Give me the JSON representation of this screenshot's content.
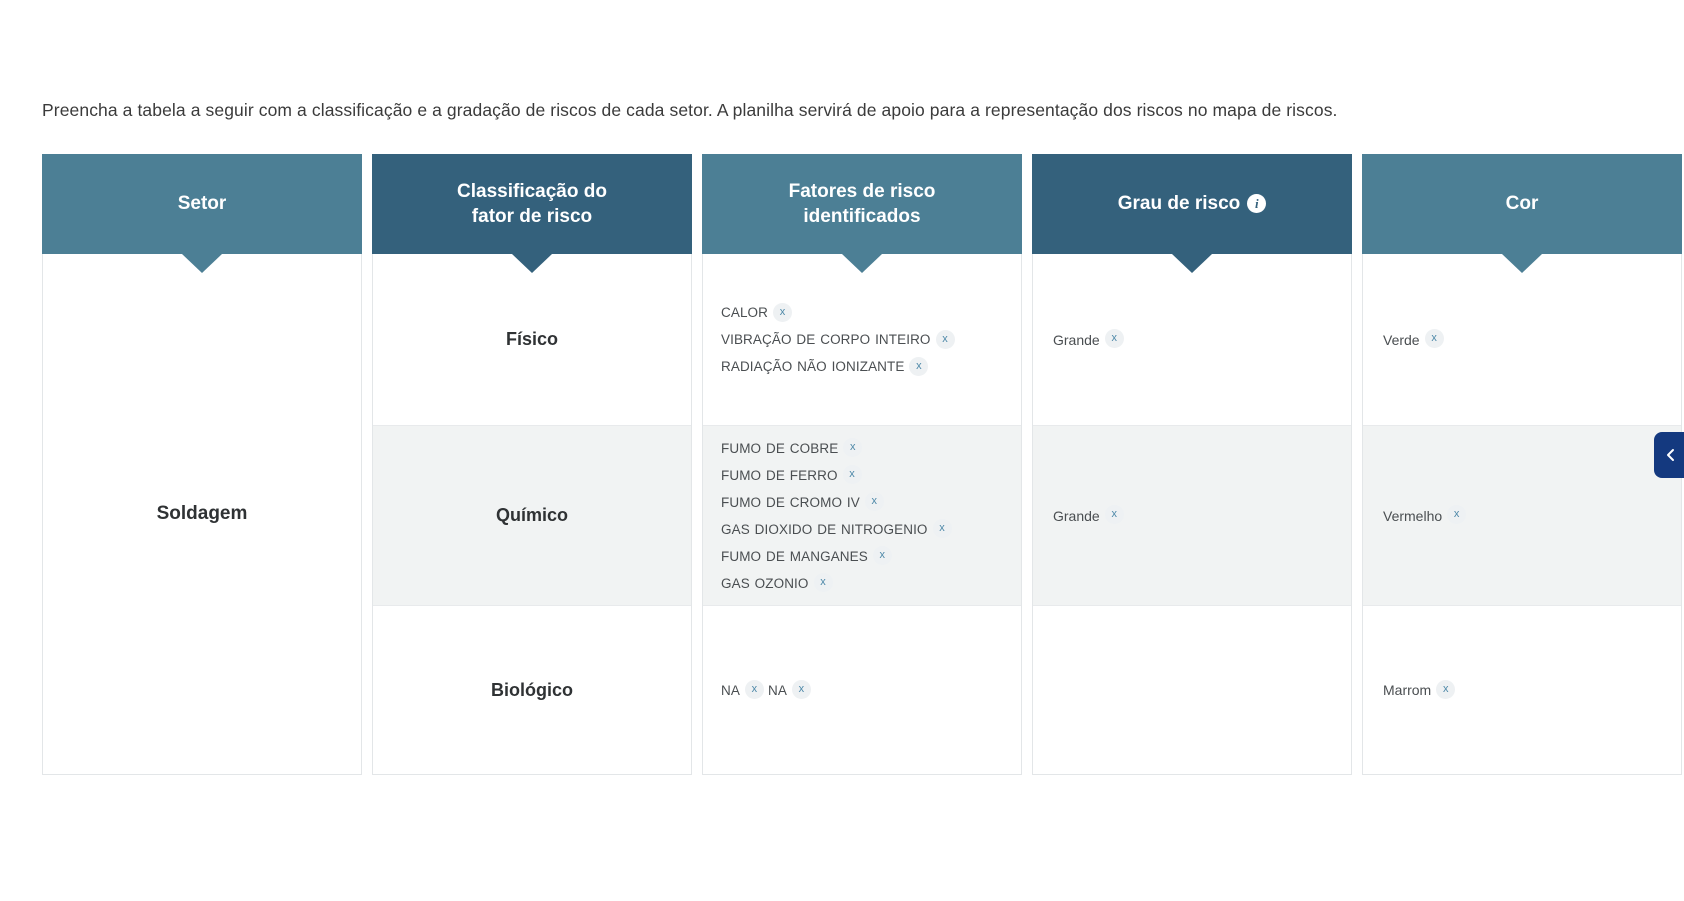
{
  "intro": {
    "text": "Preencha a tabela a seguir com a classificação e a gradação de riscos de cada setor. A planilha servirá de apoio para a representação dos riscos no mapa de riscos."
  },
  "table": {
    "headers": [
      {
        "label": "Setor",
        "tone": "light"
      },
      {
        "label": "Classificação do\nfator de risco",
        "tone": "dark"
      },
      {
        "label": "Fatores de risco\nidentificados",
        "tone": "light"
      },
      {
        "label": "Grau de risco",
        "tone": "dark",
        "icon": "info-icon"
      },
      {
        "label": "Cor",
        "tone": "light"
      }
    ],
    "sector": "Soldagem",
    "rows": [
      {
        "classification": "Físico",
        "factors": [
          "CALOR",
          "VIBRAÇÃO DE CORPO INTEIRO",
          "RADIAÇÃO NÃO IONIZANTE"
        ],
        "grade": "Grande",
        "color": "Verde",
        "shaded": false
      },
      {
        "classification": "Químico",
        "factors": [
          "FUMO DE COBRE",
          "FUMO DE FERRO",
          "FUMO DE CROMO IV",
          "GAS DIOXIDO DE NITROGENIO",
          "FUMO DE MANGANES",
          "GAS OZONIO"
        ],
        "grade": "Grande",
        "color": "Vermelho",
        "shaded": true
      },
      {
        "classification": "Biológico",
        "factors": [
          "NA",
          "NA"
        ],
        "grade": "",
        "color": "Marrom",
        "shaded": false
      }
    ],
    "remove_label": "x"
  },
  "side_tab": {
    "icon": "chevron-left-icon"
  },
  "colors": {
    "header_light": "#4c7f95",
    "header_dark": "#34617c",
    "row_shaded": "#f1f3f3",
    "tag_chip": "#eef1f3",
    "tag_x": "#4d88a8",
    "side_tab": "#14397f"
  }
}
